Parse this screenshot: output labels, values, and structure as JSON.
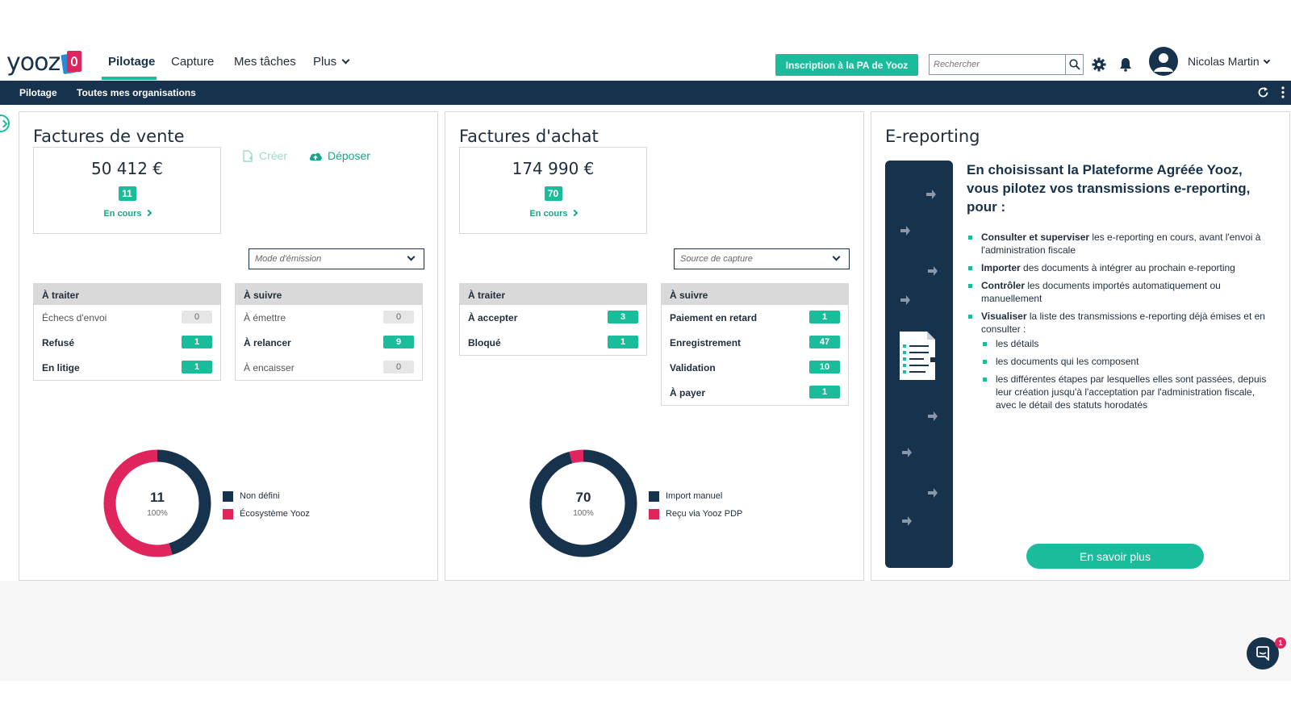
{
  "nav": {
    "logo": "yooz",
    "items": [
      {
        "label": "Pilotage",
        "active": true
      },
      {
        "label": "Capture"
      },
      {
        "label": "Mes tâches"
      },
      {
        "label": "Plus"
      }
    ],
    "cta": "Inscription à la PA de Yooz",
    "search_placeholder": "Rechercher",
    "user": "Nicolas Martin"
  },
  "subnav": {
    "items": [
      "Pilotage",
      "Toutes mes organisations"
    ]
  },
  "sales": {
    "title": "Factures de vente",
    "amount": "50 412 €",
    "count": "11",
    "status_link": "En cours",
    "create_label": "Créer",
    "upload_label": "Déposer",
    "filter_placeholder": "Mode d'émission",
    "to_process": {
      "title": "À traiter",
      "rows": [
        {
          "label": "Échecs d'envoi",
          "value": "0"
        },
        {
          "label": "Refusé",
          "value": "1"
        },
        {
          "label": "En litige",
          "value": "1"
        }
      ]
    },
    "to_follow": {
      "title": "À suivre",
      "rows": [
        {
          "label": "À émettre",
          "value": "0"
        },
        {
          "label": "À relancer",
          "value": "9"
        },
        {
          "label": "À encaisser",
          "value": "0"
        }
      ]
    },
    "donut": {
      "total": "11",
      "pct": "100%",
      "legend": [
        "Non défini",
        "Écosystème Yooz"
      ]
    }
  },
  "purchases": {
    "title": "Factures d'achat",
    "amount": "174 990 €",
    "count": "70",
    "status_link": "En cours",
    "filter_placeholder": "Source de capture",
    "to_process": {
      "title": "À traiter",
      "rows": [
        {
          "label": "À accepter",
          "value": "3"
        },
        {
          "label": "Bloqué",
          "value": "1"
        }
      ]
    },
    "to_follow": {
      "title": "À suivre",
      "rows": [
        {
          "label": "Paiement en retard",
          "value": "1"
        },
        {
          "label": "Enregistrement",
          "value": "47"
        },
        {
          "label": "Validation",
          "value": "10"
        },
        {
          "label": "À payer",
          "value": "1"
        }
      ]
    },
    "donut": {
      "total": "70",
      "pct": "100%",
      "legend": [
        "Import manuel",
        "Reçu via Yooz PDP"
      ]
    }
  },
  "ereporting": {
    "title": "E-reporting",
    "heading": "En choisissant la Plateforme Agréée Yooz, vous pilotez vos transmissions e-reporting, pour :",
    "points": [
      {
        "strong": "Consulter et superviser",
        "rest": " les e-reporting en cours, avant l'envoi à l'administration fiscale"
      },
      {
        "strong": "Importer",
        "rest": " des documents à intégrer au prochain e-reporting"
      },
      {
        "strong": "Contrôler",
        "rest": " les documents importés automatiquement ou manuellement"
      },
      {
        "strong": "Visualiser",
        "rest": " la liste des transmissions e-reporting déjà émises et en consulter :"
      }
    ],
    "subpoints": [
      "les détails",
      "les documents qui les composent",
      "les différentes étapes par lesquelles elles sont passées, depuis leur création jusqu'à l'acceptation par l'administration fiscale, avec le détail des statuts horodatés"
    ],
    "cta": "En savoir plus"
  },
  "chart_data": [
    {
      "type": "pie",
      "title": "",
      "categories": [
        "Non défini",
        "Écosystème Yooz"
      ],
      "values": [
        5,
        6
      ],
      "colors": [
        "#17324d",
        "#e0245e"
      ]
    },
    {
      "type": "pie",
      "title": "",
      "categories": [
        "Import manuel",
        "Reçu via Yooz PDP"
      ],
      "values": [
        67,
        3
      ],
      "colors": [
        "#17324d",
        "#e0245e"
      ]
    }
  ],
  "chat": {
    "badge": "1"
  },
  "colors": {
    "primary": "#17324d",
    "accent": "#1abc9c",
    "pink": "#e0245e"
  }
}
